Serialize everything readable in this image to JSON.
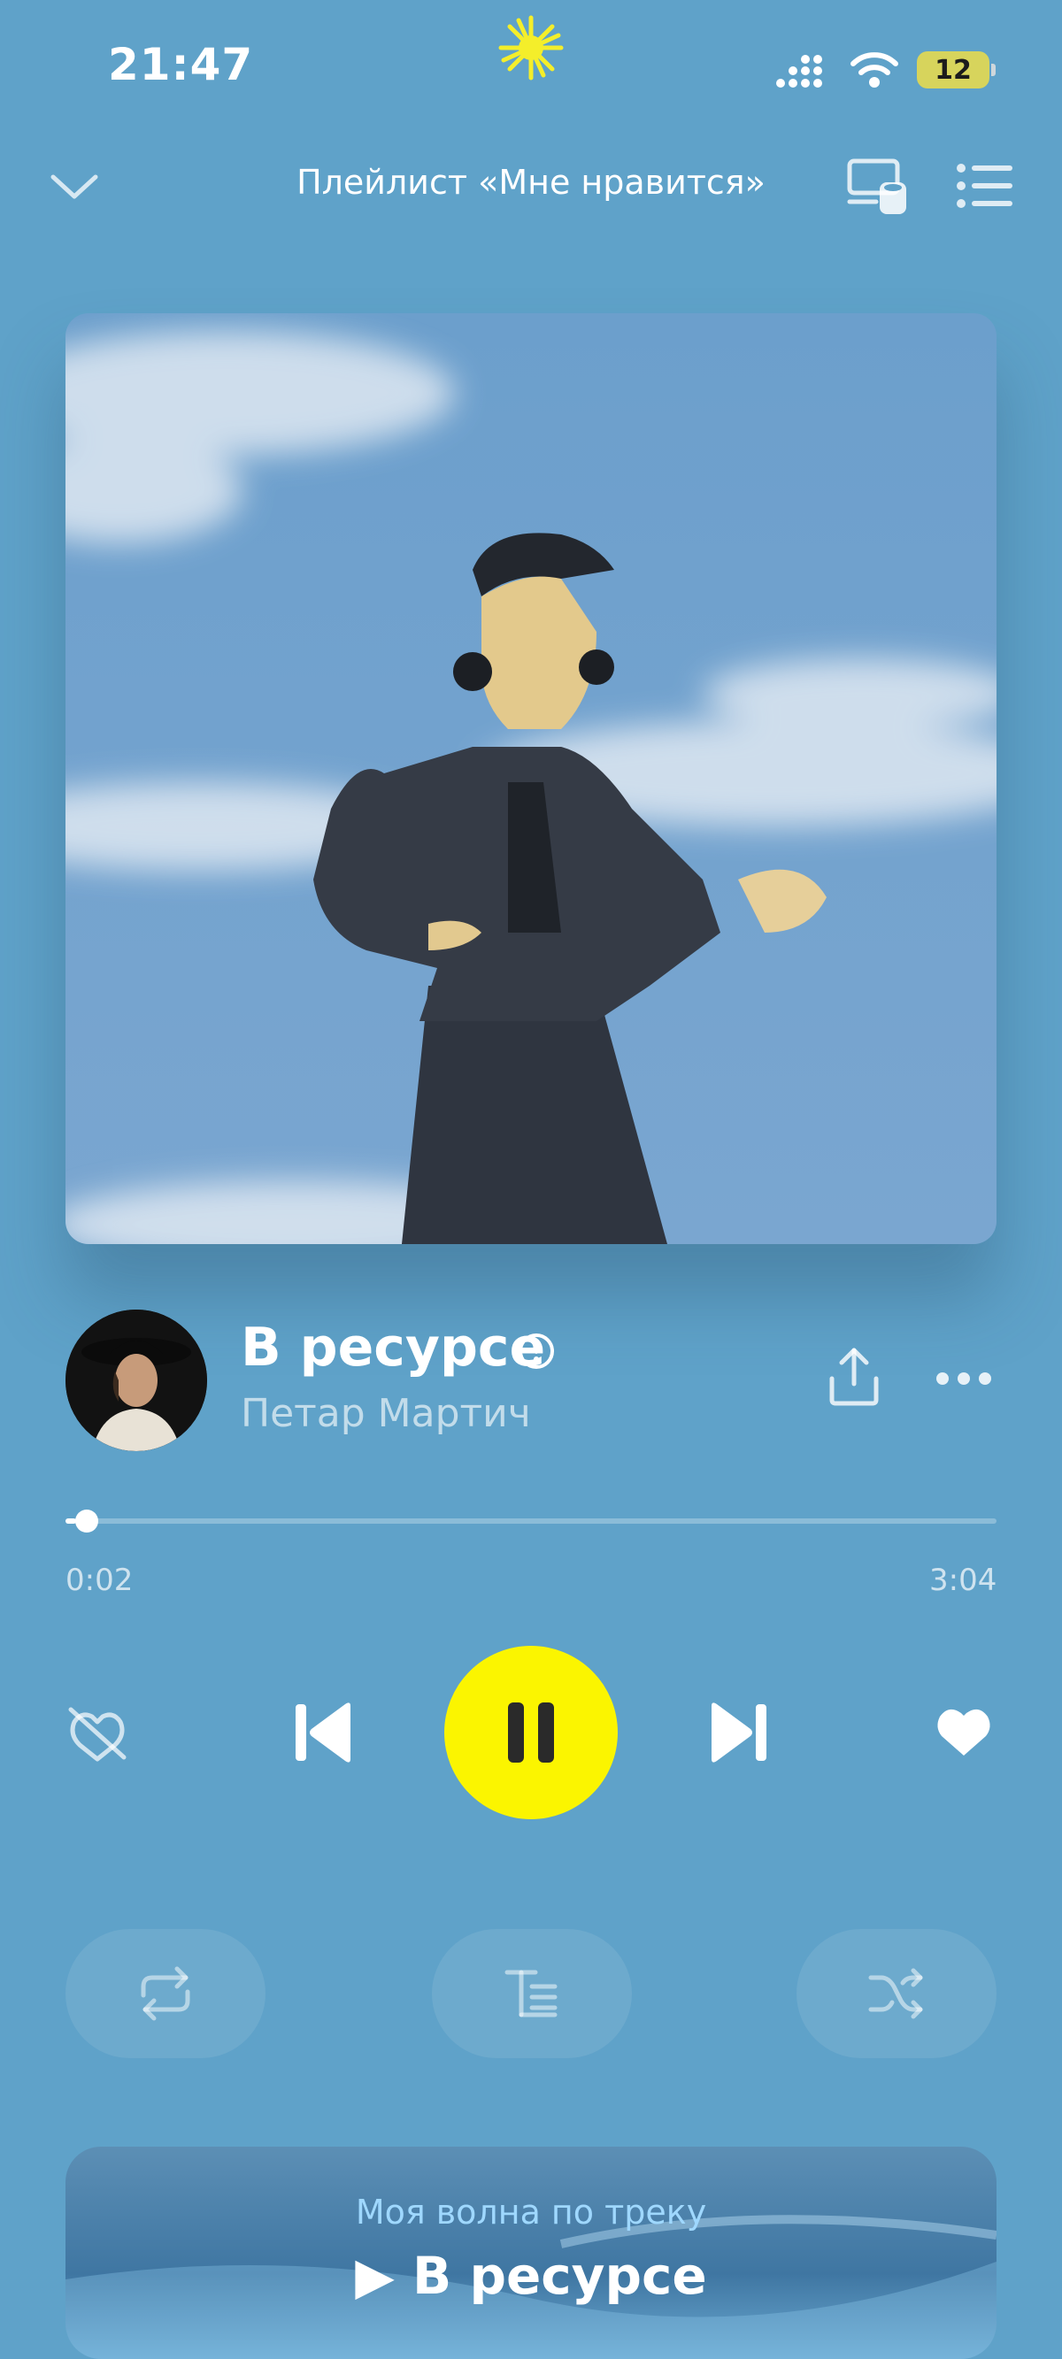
{
  "status_bar": {
    "time": "21:47",
    "battery": "12"
  },
  "header": {
    "title": "Плейлист «Мне нравится»"
  },
  "track": {
    "title": "В ресурсе",
    "artist": "Петар Мартич",
    "explicit": true
  },
  "progress": {
    "current": "0:02",
    "total": "3:04",
    "fraction": 0.011
  },
  "wave": {
    "subtitle": "Моя волна по треку",
    "title": "▶ В ресурсе"
  },
  "colors": {
    "background": "#5fa2c9",
    "play_button": "#fbf500",
    "wave_subtitle": "#9fd8ff"
  },
  "icons": {
    "collapse": "chevron-down-icon",
    "devices": "devices-icon",
    "queue": "queue-list-icon",
    "explicit": "explicit-icon",
    "share": "share-icon",
    "more": "more-icon",
    "dislike": "dislike-icon",
    "prev": "previous-track-icon",
    "pause": "pause-icon",
    "next": "next-track-icon",
    "like": "heart-icon",
    "repeat": "repeat-icon",
    "lyrics": "lyrics-icon",
    "shuffle": "shuffle-icon"
  }
}
